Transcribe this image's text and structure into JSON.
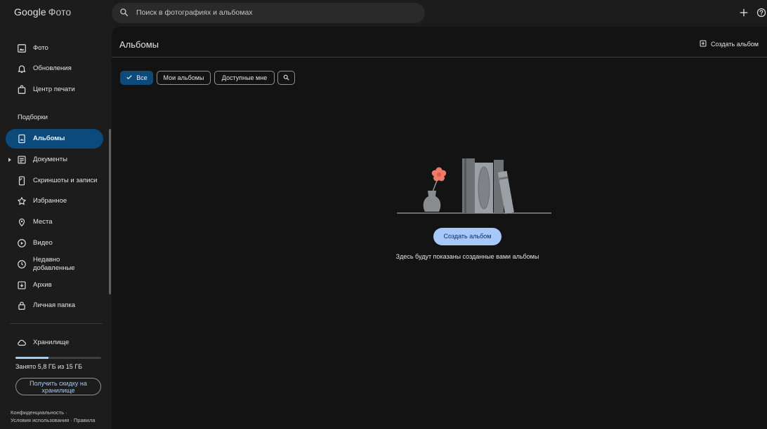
{
  "app": {
    "logo_google": "Google",
    "logo_product": "Фото"
  },
  "search": {
    "placeholder": "Поиск в фотографиях и альбомах"
  },
  "topbar": {
    "add_icon": "plus-icon",
    "help_icon": "help-circle-icon"
  },
  "sidebar": {
    "items_top": [
      {
        "label": "Фото",
        "icon": "photo-icon"
      },
      {
        "label": "Обновления",
        "icon": "bell-icon"
      },
      {
        "label": "Центр печати",
        "icon": "print-bag-icon"
      }
    ],
    "section_label": "Подборки",
    "items_collections": [
      {
        "label": "Альбомы",
        "icon": "album-icon",
        "active": true
      },
      {
        "label": "Документы",
        "icon": "document-icon"
      },
      {
        "label": "Скриншоты и записи",
        "icon": "phone-screenshot-icon"
      },
      {
        "label": "Избранное",
        "icon": "star-icon"
      },
      {
        "label": "Места",
        "icon": "location-pin-icon"
      },
      {
        "label": "Видео",
        "icon": "play-circle-icon"
      },
      {
        "label": "Недавно добавленные",
        "icon": "clock-icon"
      },
      {
        "label": "Архив",
        "icon": "archive-icon"
      },
      {
        "label": "Личная папка",
        "icon": "lock-folder-icon"
      }
    ],
    "storage": {
      "label": "Хранилище",
      "icon": "cloud-icon",
      "usage_text": "Занято 5,8 ГБ из 15 ГБ",
      "used_fraction": 0.387,
      "promo_button": "Получить скидку на хранилище"
    },
    "footer": {
      "privacy": "Конфиденциальность",
      "terms": "Условия использования",
      "rules": "Правила",
      "separator": "·"
    }
  },
  "main": {
    "title": "Альбомы",
    "create_album_top": "Создать альбом",
    "filters": [
      {
        "label": "Все",
        "active": true
      },
      {
        "label": "Мои альбомы",
        "active": false
      },
      {
        "label": "Доступные мне",
        "active": false
      }
    ],
    "filter_search_icon": "search-icon",
    "empty_state": {
      "button": "Создать альбом",
      "message": "Здесь будут показаны созданные вами альбомы"
    }
  },
  "colors": {
    "accent": "#a8c7fa",
    "active_bg": "#0b4a7a",
    "background": "#131313",
    "sidebar_bg": "#1c1c1c",
    "flower": "#f07a6a"
  }
}
